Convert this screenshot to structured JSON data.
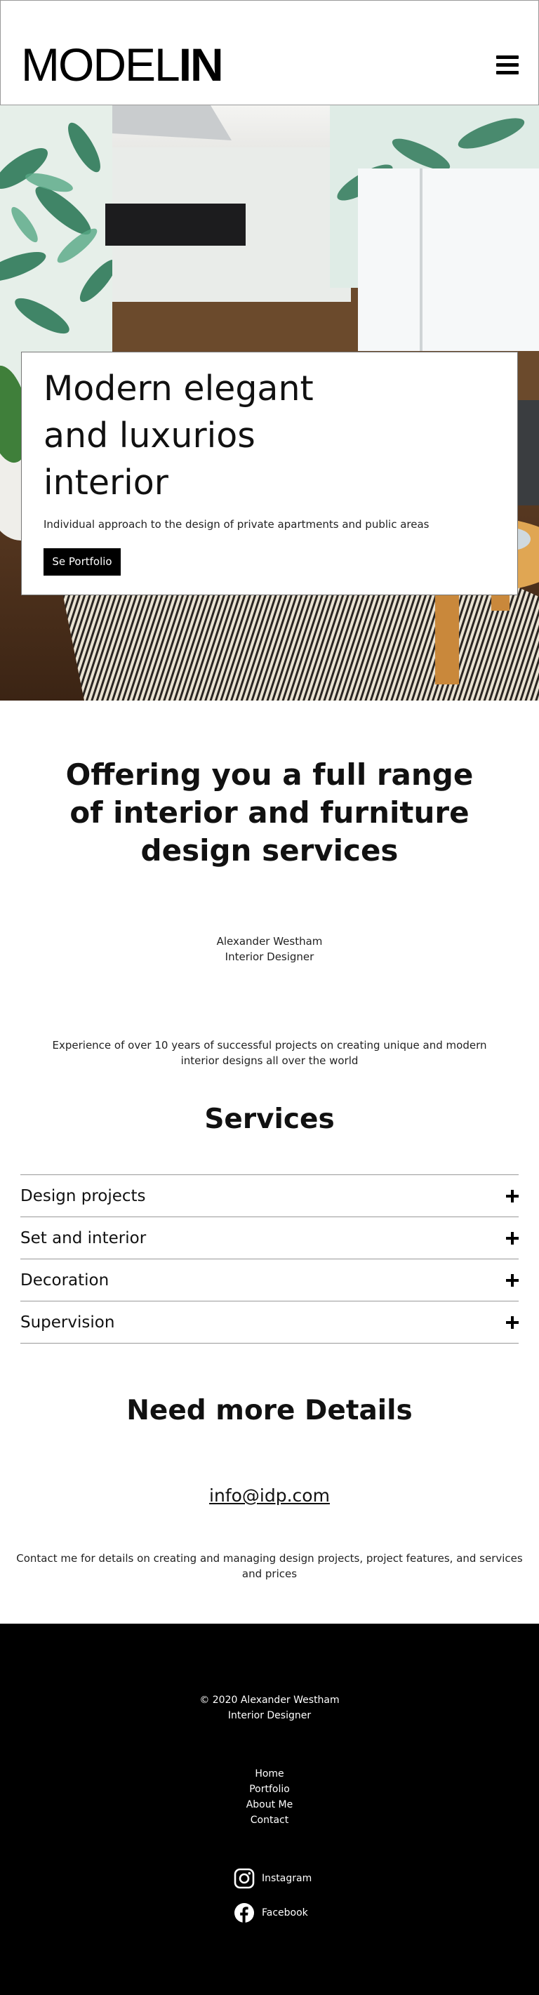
{
  "header": {
    "logo_light": "MODEL",
    "logo_bold": "IN",
    "menu_icon": "hamburger-menu-icon"
  },
  "hero": {
    "title": "Modern elegant and luxurios interior",
    "subtitle": "Individual approach to the design of private apartments and public areas",
    "button_label": "Se Portfolio"
  },
  "intro": {
    "heading": "Offering you a full range of interior and furniture design services",
    "name": "Alexander Westham",
    "role": "Interior Designer",
    "experience": "Experience of over 10 years of successful projects on creating unique and modern interior designs all over the world"
  },
  "services": {
    "title": "Services",
    "items": [
      {
        "label": "Design projects"
      },
      {
        "label": "Set and interior"
      },
      {
        "label": "Decoration"
      },
      {
        "label": "Supervision"
      }
    ],
    "expand_icon": "plus-icon"
  },
  "details": {
    "title": "Need more Details",
    "email": "info@idp.com",
    "text": "Contact me for details on creating and managing design projects, project features, and services and prices"
  },
  "footer": {
    "copyright": "© 2020 Alexander Westham",
    "role": "Interior Designer",
    "nav": [
      "Home",
      "Portfolio",
      "About Me",
      "Contact"
    ],
    "social": [
      {
        "label": "Instagram",
        "icon": "instagram-icon"
      },
      {
        "label": "Facebook",
        "icon": "facebook-icon"
      }
    ]
  },
  "colors": {
    "text": "#111111",
    "footer_bg": "#000000",
    "button_bg": "#000000",
    "divider": "#999999"
  }
}
